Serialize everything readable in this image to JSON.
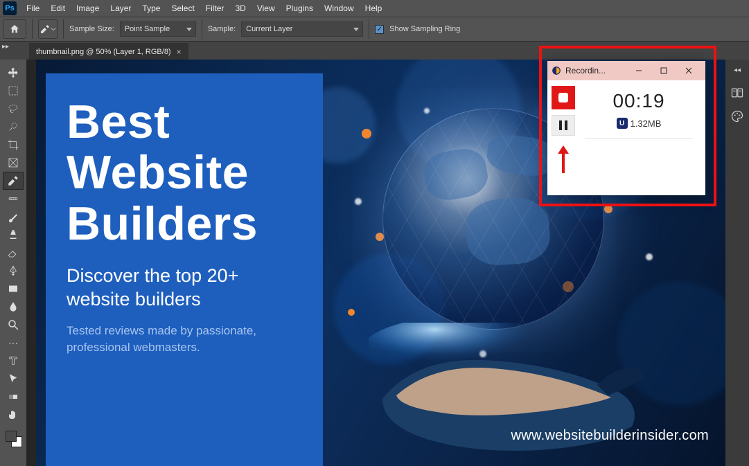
{
  "menubar": {
    "logo": "Ps",
    "items": [
      "File",
      "Edit",
      "Image",
      "Layer",
      "Type",
      "Select",
      "Filter",
      "3D",
      "View",
      "Plugins",
      "Window",
      "Help"
    ]
  },
  "options": {
    "sample_size_label": "Sample Size:",
    "sample_size_value": "Point Sample",
    "sample_label": "Sample:",
    "sample_value": "Current Layer",
    "sampling_ring_label": "Show Sampling Ring"
  },
  "document": {
    "tab_title": "thumbnail.png @ 50% (Layer 1, RGB/8)"
  },
  "thumbnail": {
    "headline_l1": "Best",
    "headline_l2": "Website",
    "headline_l3": "Builders",
    "subhead": "Discover the top 20+ website builders",
    "body": "Tested reviews made by passionate, professional webmasters.",
    "url": "www.websitebuilderinsider.com"
  },
  "recorder": {
    "title": "Recordin...",
    "time": "00:19",
    "size": "1.32MB",
    "badge": "U"
  },
  "colors": {
    "ps_bg": "#323232",
    "panel_blue": "#1e5fbe",
    "highlight_red": "#e11717"
  }
}
